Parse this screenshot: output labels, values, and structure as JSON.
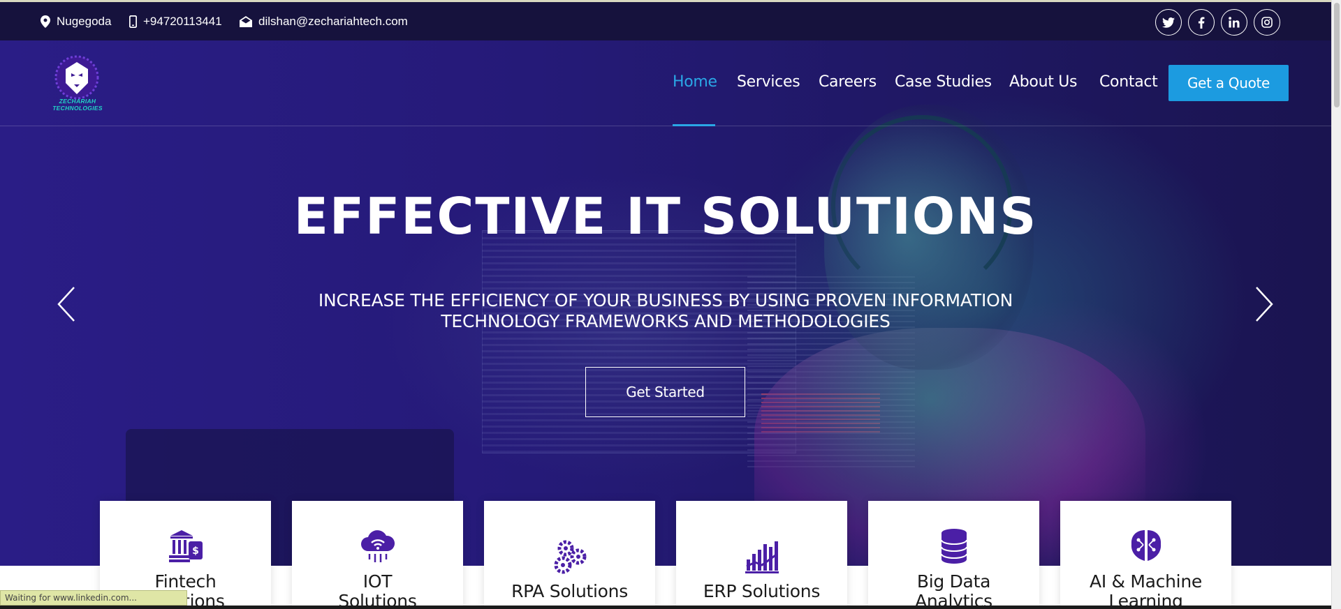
{
  "topbar": {
    "location": "Nugegoda",
    "phone": "+94720113441",
    "email": "dilshan@zechariahtech.com",
    "social": [
      {
        "icon": "twitter-icon",
        "glyph": "🐦"
      },
      {
        "icon": "facebook-icon",
        "glyph": "f"
      },
      {
        "icon": "linkedin-icon",
        "glyph": "in"
      },
      {
        "icon": "instagram-icon",
        "glyph": "◎"
      }
    ]
  },
  "header": {
    "logo_text": "ZECHARIAH TECHNOLOGIES",
    "nav": [
      "Home",
      "Services",
      "Careers",
      "Case Studies",
      "About Us",
      "Contact"
    ],
    "active_nav": "Home",
    "quote_label": "Get a Quote"
  },
  "hero": {
    "title": "EFFECTIVE IT SOLUTIONS",
    "subtitle": "INCREASE THE EFFICIENCY OF YOUR BUSINESS BY USING PROVEN INFORMATION TECHNOLOGY FRAMEWORKS AND METHODOLOGIES",
    "cta_label": "Get Started"
  },
  "cards": [
    {
      "line1": "Fintech",
      "line2": "Solutions",
      "icon": "bank-icon"
    },
    {
      "line1": "IOT",
      "line2": "Solutions",
      "icon": "cloud-wifi-icon"
    },
    {
      "line1": "RPA Solutions",
      "line2": "",
      "icon": "gears-icon"
    },
    {
      "line1": "ERP Solutions",
      "line2": "",
      "icon": "chart-bars-icon"
    },
    {
      "line1": "Big Data",
      "line2": "Analytics",
      "icon": "database-icon"
    },
    {
      "line1": "AI & Machine",
      "line2": "Learning",
      "icon": "brain-icon"
    }
  ],
  "status_text": "Waiting for www.linkedin.com...",
  "colors": {
    "accent": "#1c9be0",
    "active_nav": "#2aa7e6",
    "icon_purple": "#4b1fa6",
    "topbar_bg": "#16123d"
  }
}
